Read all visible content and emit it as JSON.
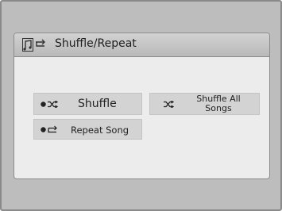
{
  "screen": {
    "title": "Shuffle/Repeat",
    "title_icons": [
      "music-note-icon",
      "repeat-icon"
    ]
  },
  "options": {
    "shuffle": {
      "label": "Shuffle",
      "icon": "shuffle-icon",
      "selected": true
    },
    "shuffle_all": {
      "label": "Shuffle All Songs",
      "icon": "shuffle-icon",
      "selected": false
    },
    "repeat": {
      "label": "Repeat Song",
      "icon": "repeat-icon",
      "selected": false
    }
  },
  "colors": {
    "bezel": "#bdbdbd",
    "screen_bg": "#ececec",
    "titlebar": "#c4c4c4",
    "option_bg": "#d3d3d3",
    "text": "#222222"
  }
}
